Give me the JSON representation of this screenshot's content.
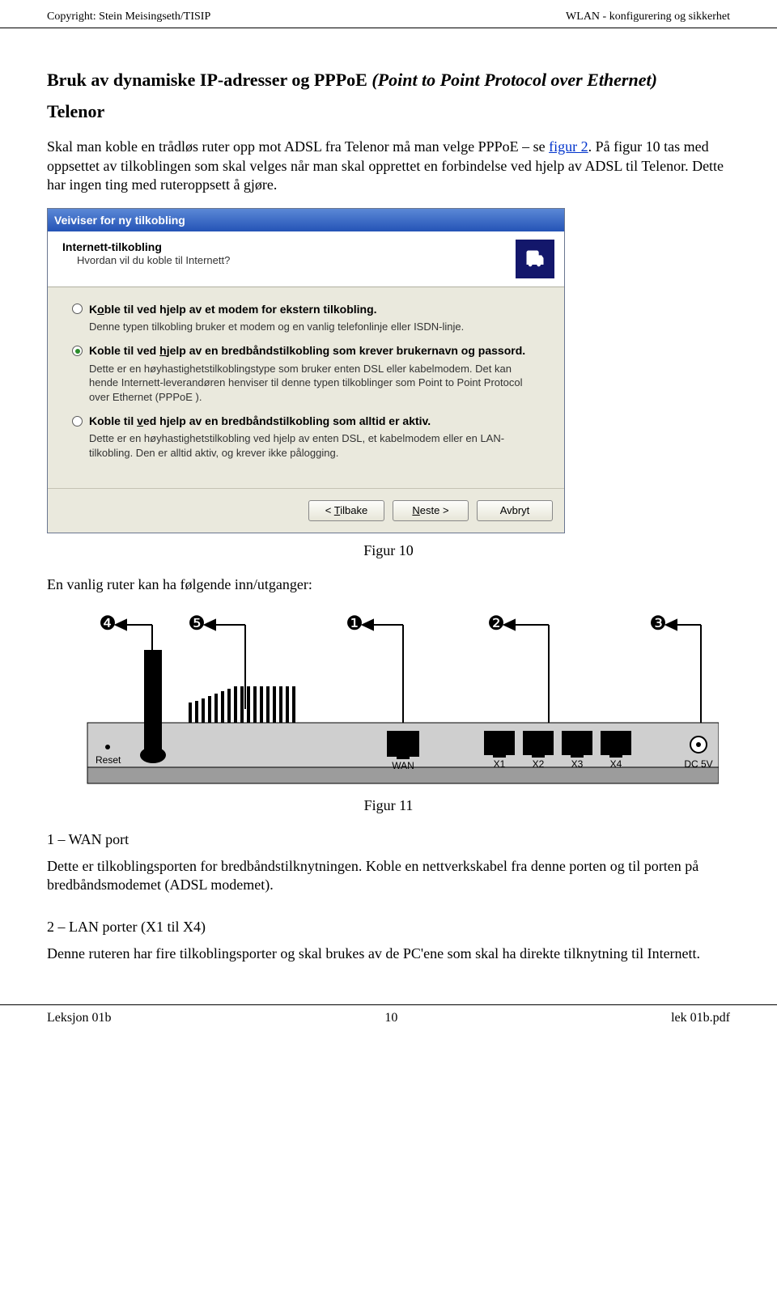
{
  "header": {
    "left": "Copyright: Stein Meisingseth/TISIP",
    "right": "WLAN - konfigurering og sikkerhet"
  },
  "heading": {
    "plain": "Bruk av dynamiske IP-adresser og PPPoE ",
    "italic": "(Point to Point Protocol over Ethernet)"
  },
  "subheading": "Telenor",
  "p1_a": "Skal man koble en trådløs ruter opp mot ADSL fra Telenor må man velge PPPoE – se ",
  "p1_link": "figur 2",
  "p1_b": ". På figur 10 tas med oppsettet av tilkoblingen som skal velges når man skal opprettet en forbindelse ved hjelp av ADSL til Telenor. Dette har ingen ting med ruteroppsett å gjøre.",
  "wizard": {
    "title": "Veiviser for ny tilkobling",
    "banner_title": "Internett-tilkobling",
    "banner_sub": "Hvordan vil du koble til Internett?",
    "opt1": {
      "label_pre": "K",
      "label_u": "o",
      "label_post": "ble til ved hjelp av et modem for ekstern tilkobling.",
      "desc": "Denne typen tilkobling bruker et modem og en vanlig telefonlinje eller ISDN-linje."
    },
    "opt2": {
      "label_pre": "Koble til ved ",
      "label_u": "h",
      "label_post": "jelp av en bredbåndstilkobling som krever brukernavn og passord.",
      "desc": "Dette er en høyhastighetstilkoblingstype som bruker enten DSL eller kabelmodem. Det kan hende Internett-leverandøren henviser til denne typen tilkoblinger som Point to Point Protocol over Ethernet (PPPoE )."
    },
    "opt3": {
      "label_pre": "Koble til ",
      "label_u": "v",
      "label_post": "ed hjelp av en bredbåndstilkobling som alltid er aktiv.",
      "desc": "Dette er en høyhastighetstilkobling ved hjelp av enten DSL, et kabelmodem eller en LAN-tilkobling. Den er alltid aktiv, og krever ikke pålogging."
    },
    "btn_back_pre": "< ",
    "btn_back_u": "T",
    "btn_back_post": "ilbake",
    "btn_next_u": "N",
    "btn_next_post": "este >",
    "btn_cancel": "Avbryt"
  },
  "fig10": "Figur 10",
  "p2": "En vanlig ruter kan ha følgende inn/utganger:",
  "router_labels": {
    "reset": "Reset",
    "wan": "WAN",
    "x1": "X1",
    "x2": "X2",
    "x3": "X3",
    "x4": "X4",
    "dc": "DC 5V",
    "n1": "❶",
    "n2": "❷",
    "n3": "❸",
    "n4": "❹",
    "n5": "❺"
  },
  "fig11": "Figur 11",
  "sec1_title": "1 – WAN port",
  "sec1_body": "Dette er tilkoblingsporten for bredbåndstilknytningen. Koble en nettverkskabel fra denne porten og til porten på bredbåndsmodemet (ADSL modemet).",
  "sec2_title": "2 – LAN porter (X1 til X4)",
  "sec2_body": "Denne ruteren har fire tilkoblingsporter og skal brukes av de PC'ene som skal ha direkte tilknytning til Internett.",
  "footer": {
    "left": "Leksjon 01b",
    "center": "10",
    "right": "lek 01b.pdf"
  }
}
